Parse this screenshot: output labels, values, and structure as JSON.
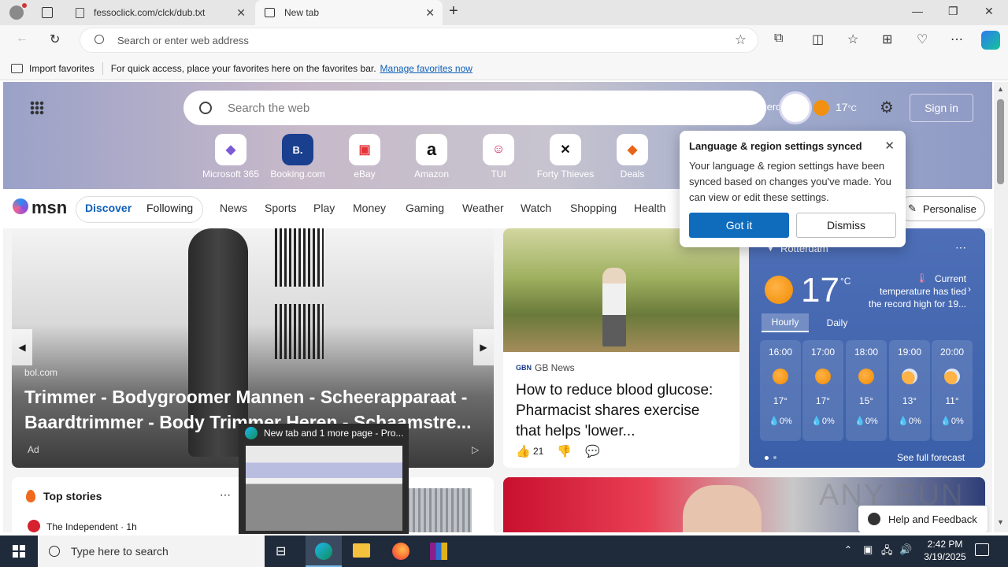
{
  "browser": {
    "tabs": [
      {
        "label": "fessoclick.com/clck/dub.txt"
      },
      {
        "label": "New tab"
      }
    ],
    "address_placeholder": "Search or enter web address",
    "favorites": {
      "import_label": "Import favorites",
      "hint": "For quick access, place your favorites here on the favorites bar.",
      "manage_link": "Manage favorites now"
    }
  },
  "newtab": {
    "search_placeholder": "Search the web",
    "overlap_text": "terdam",
    "temp": "17",
    "temp_unit": "°C",
    "sign_in": "Sign in",
    "tiles": [
      {
        "label": "Microsoft 365",
        "glyph": "◆",
        "color": "#7b5cd6"
      },
      {
        "label": "Booking.com",
        "glyph": "B.",
        "color": "#1a3f8f"
      },
      {
        "label": "eBay",
        "glyph": "▣",
        "color": "#e53238"
      },
      {
        "label": "Amazon",
        "glyph": "a",
        "color": "#111111"
      },
      {
        "label": "TUI",
        "glyph": "☺",
        "color": "#d4145a"
      },
      {
        "label": "Forty Thieves",
        "glyph": "✕",
        "color": "#111111"
      },
      {
        "label": "Deals",
        "glyph": "◆",
        "color": "#e8641b"
      }
    ],
    "msn_logo": "msn",
    "nav": {
      "discover": "Discover",
      "following": "Following",
      "items": [
        "News",
        "Sports",
        "Play",
        "Money",
        "Gaming",
        "Weather",
        "Watch",
        "Shopping",
        "Health"
      ],
      "personalise": "Personalise"
    },
    "ad": {
      "source": "bol.com",
      "title": "Trimmer - Bodygroomer Mannen - Scheerapparaat - Baardtrimmer - Body Trimmer Heren - Schaamstre...",
      "badge": "Ad"
    },
    "story": {
      "source": "GB News",
      "title": "How to reduce blood glucose: Pharmacist shares exercise that helps 'lower...",
      "likes": "21"
    },
    "top_stories": {
      "heading": "Top stories",
      "first_source": "The Independent · 1h"
    },
    "popup": {
      "title": "Language & region settings synced",
      "body": "Your language & region settings have been synced based on changes you've made. You can view or edit these settings.",
      "primary": "Got it",
      "secondary": "Dismiss"
    },
    "weather": {
      "location": "Rotterdam",
      "temp": "17",
      "unit": "°C",
      "note": "Current temperature has tied the record high for 19...",
      "tab_hourly": "Hourly",
      "tab_daily": "Daily",
      "hours": [
        {
          "time": "16:00",
          "temp": "17°",
          "rain": "0%"
        },
        {
          "time": "17:00",
          "temp": "17°",
          "rain": "0%"
        },
        {
          "time": "18:00",
          "temp": "15°",
          "rain": "0%"
        },
        {
          "time": "19:00",
          "temp": "13°",
          "rain": "0%"
        },
        {
          "time": "20:00",
          "temp": "11°",
          "rain": "0%"
        }
      ],
      "forecast_link": "See full forecast"
    },
    "help": "Help and Feedback",
    "watermark": "ANY RUN"
  },
  "thumbnail": {
    "title": "New tab and 1 more page - Pro..."
  },
  "taskbar": {
    "search_placeholder": "Type here to search",
    "time": "2:42 PM",
    "date": "3/19/2025"
  }
}
